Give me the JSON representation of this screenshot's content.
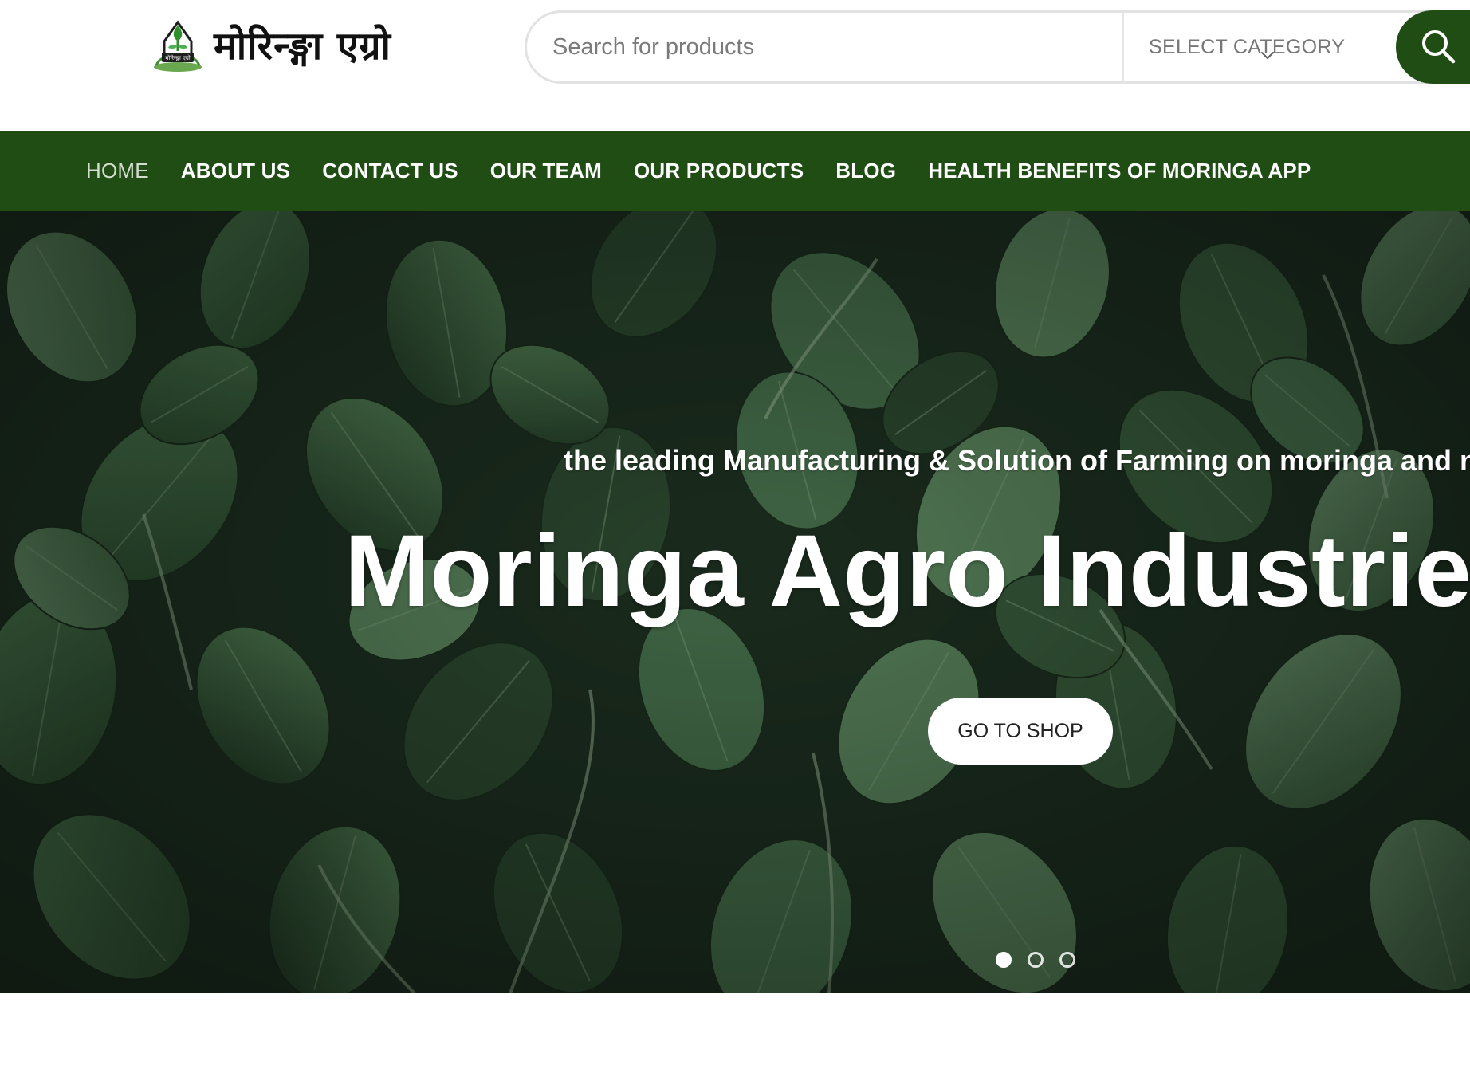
{
  "header": {
    "logo_text": "मोरिन्ङ्गा एग्रो",
    "logo_seal_text": "मोरिन्ङ्गा एग्रो",
    "search": {
      "placeholder": "Search for products",
      "value": ""
    },
    "category_label": "SELECT CATEGORY"
  },
  "nav": {
    "items": [
      {
        "label": "HOME",
        "active": true
      },
      {
        "label": "ABOUT US",
        "active": false
      },
      {
        "label": "CONTACT US",
        "active": false
      },
      {
        "label": "OUR TEAM",
        "active": false
      },
      {
        "label": "OUR PRODUCTS",
        "active": false
      },
      {
        "label": "BLOG",
        "active": false
      },
      {
        "label": "HEALTH BENEFITS OF MORINGA APP",
        "active": false
      }
    ]
  },
  "hero": {
    "tagline": "the leading Manufacturing & Solution of Farming on moringa and nurse",
    "title": "Moringa Agro Industries P",
    "cta_label": "GO TO SHOP",
    "slides_total": 3,
    "active_slide": 1
  },
  "colors": {
    "brand_green": "#1f4d14",
    "nav_text": "#ffffff",
    "nav_active_text": "#d4dccf",
    "leaf_dark": "#25382a",
    "leaf_light": "#5c8560"
  },
  "icons": {
    "logo": "moringa-leaf-emblem-icon",
    "category_dropdown": "chevron-down-icon",
    "search": "search-icon"
  }
}
